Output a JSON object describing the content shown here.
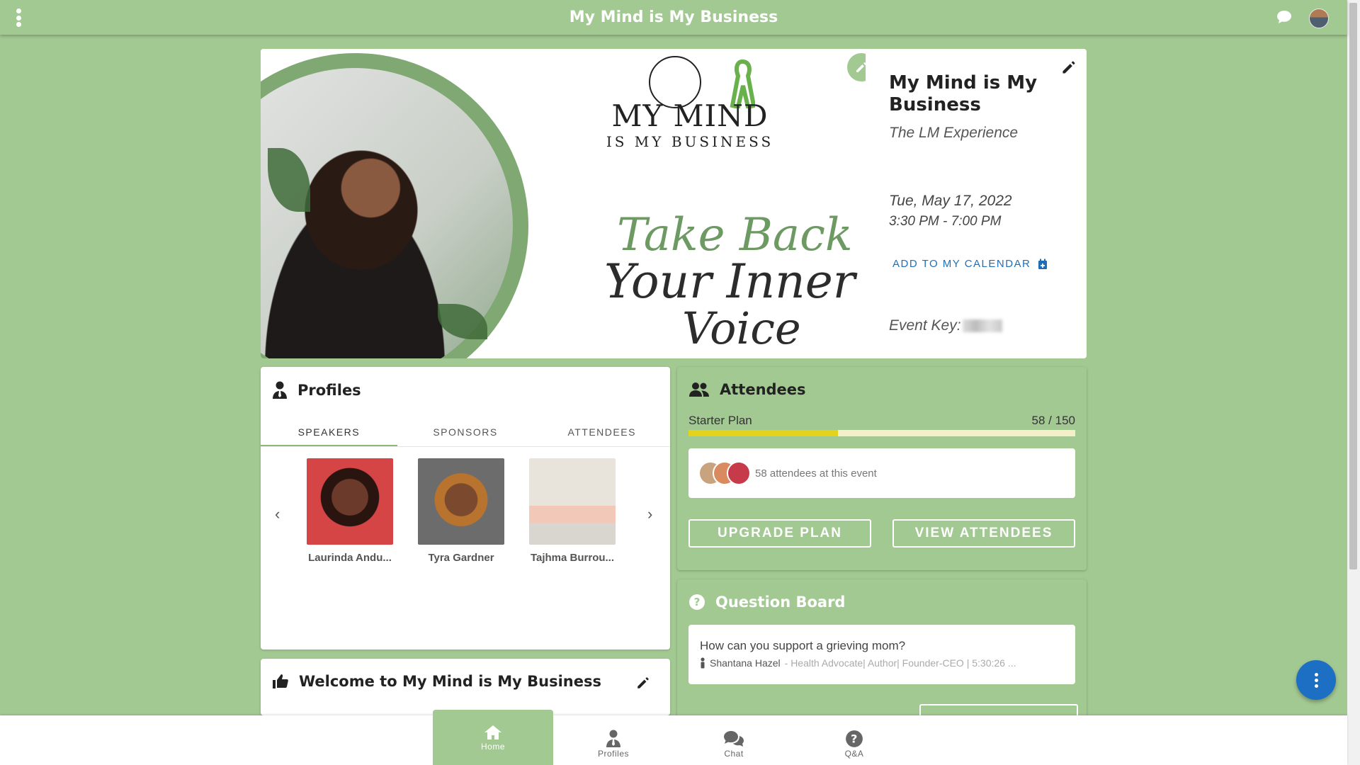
{
  "app": {
    "title": "My Mind is My Business"
  },
  "event": {
    "name": "My Mind is My Business",
    "subtitle": "The LM Experience",
    "date": "Tue, May 17, 2022",
    "time": "3:30 PM - 7:00 PM",
    "add_calendar_label": "ADD TO MY CALENDAR",
    "event_key_label": "Event Key:"
  },
  "banner": {
    "logo_line1": "MY MIND",
    "logo_line2": "IS MY BUSINESS",
    "script_line1": "Take Back",
    "script_line2": "Your Inner",
    "script_line3": "Voice"
  },
  "profiles": {
    "title": "Profiles",
    "tabs": [
      "SPEAKERS",
      "SPONSORS",
      "ATTENDEES"
    ],
    "people": [
      {
        "name": "Laurinda Andu..."
      },
      {
        "name": "Tyra Gardner"
      },
      {
        "name": "Tajhma Burrou..."
      }
    ]
  },
  "welcome": {
    "title": "Welcome to My Mind is My Business"
  },
  "attendees": {
    "title": "Attendees",
    "plan_name": "Starter Plan",
    "plan_count": "58 / 150",
    "plan_fraction": 0.3867,
    "summary": "58 attendees at this event",
    "upgrade_label": "UPGRADE PLAN",
    "view_label": "VIEW ATTENDEES"
  },
  "question_board": {
    "title": "Question Board",
    "question": "How can you support a grieving mom?",
    "author": "Shantana Hazel",
    "author_role": "- Health Advocate| Author| Founder-CEO  | 5:30:26 ..."
  },
  "bottom_nav": {
    "items": [
      {
        "label": "Home",
        "icon": "home-icon"
      },
      {
        "label": "Profiles",
        "icon": "profiles-icon"
      },
      {
        "label": "Chat",
        "icon": "chat-icon"
      },
      {
        "label": "Q&A",
        "icon": "help-icon"
      }
    ]
  },
  "colors": {
    "primary": "#a3c993",
    "accent_blue": "#1f6fb8",
    "fab": "#1d6fc4",
    "plan_fill": "#e4d21b"
  }
}
